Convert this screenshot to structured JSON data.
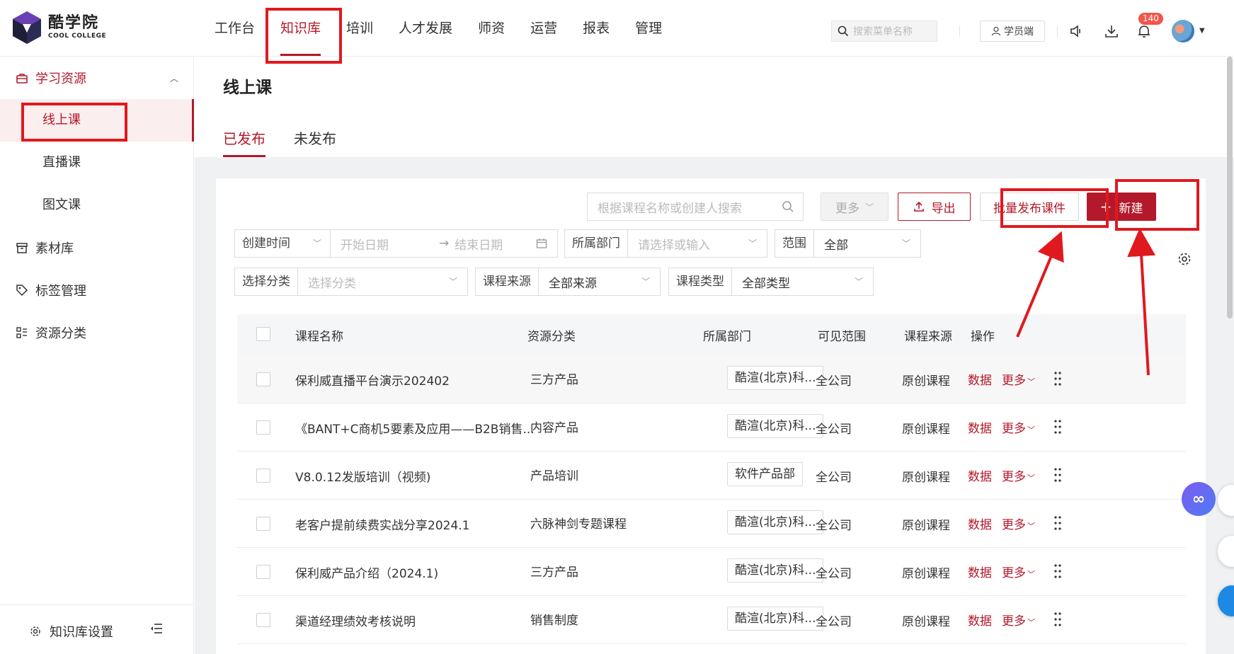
{
  "header": {
    "logo_cn": "酷学院",
    "logo_en": "COOL COLLEGE",
    "nav": [
      "工作台",
      "知识库",
      "培训",
      "人才发展",
      "师资",
      "运营",
      "报表",
      "管理"
    ],
    "search_placeholder": "搜索菜单名称",
    "student_button": "学员端",
    "notification_count": "140",
    "accent_color": "#b3192a"
  },
  "sidebar": {
    "group_label": "学习资源",
    "sub_items": [
      "线上课",
      "直播课",
      "图文课"
    ],
    "items": [
      "素材库",
      "标签管理",
      "资源分类"
    ],
    "footer_label": "知识库设置"
  },
  "main": {
    "page_title": "线上课",
    "tabs": [
      "已发布",
      "未发布"
    ],
    "search_placeholder": "根据课程名称或创建人搜索",
    "more_button": "更多",
    "export_button": "导出",
    "batch_button": "批量发布课件",
    "new_button": "新建",
    "filters": {
      "time_select": "创建时间",
      "start_date": "开始日期",
      "end_date": "结束日期",
      "dept_label": "所属部门",
      "dept_placeholder": "请选择或输入",
      "scope_label": "范围",
      "scope_value": "全部",
      "category_label": "选择分类",
      "category_placeholder": "选择分类",
      "source_label": "课程来源",
      "source_value": "全部来源",
      "type_label": "课程类型",
      "type_value": "全部类型"
    },
    "table": {
      "headers": [
        "课程名称",
        "资源分类",
        "所属部门",
        "可见范围",
        "课程来源",
        "操作"
      ],
      "rows": [
        {
          "name": "保利威直播平台演示202402",
          "category": "三方产品",
          "dept": "酷渲(北京)科...",
          "scope": "全公司",
          "source": "原创课程"
        },
        {
          "name": "《BANT+C商机5要素及应用——B2B销售...",
          "category": "内容产品",
          "dept": "酷渲(北京)科...",
          "scope": "全公司",
          "source": "原创课程"
        },
        {
          "name": "V8.0.12发版培训（视频)",
          "category": "产品培训",
          "dept": "软件产品部",
          "scope": "全公司",
          "source": "原创课程"
        },
        {
          "name": "老客户提前续费实战分享2024.1",
          "category": "六脉神剑专题课程",
          "dept": "酷渲(北京)科...",
          "scope": "全公司",
          "source": "原创课程"
        },
        {
          "name": "保利威产品介绍（2024.1)",
          "category": "三方产品",
          "dept": "酷渲(北京)科...",
          "scope": "全公司",
          "source": "原创课程"
        },
        {
          "name": "渠道经理绩效考核说明",
          "category": "销售制度",
          "dept": "酷渲(北京)科...",
          "scope": "全公司",
          "source": "原创课程"
        }
      ],
      "op_data": "数据",
      "op_more": "更多"
    }
  }
}
